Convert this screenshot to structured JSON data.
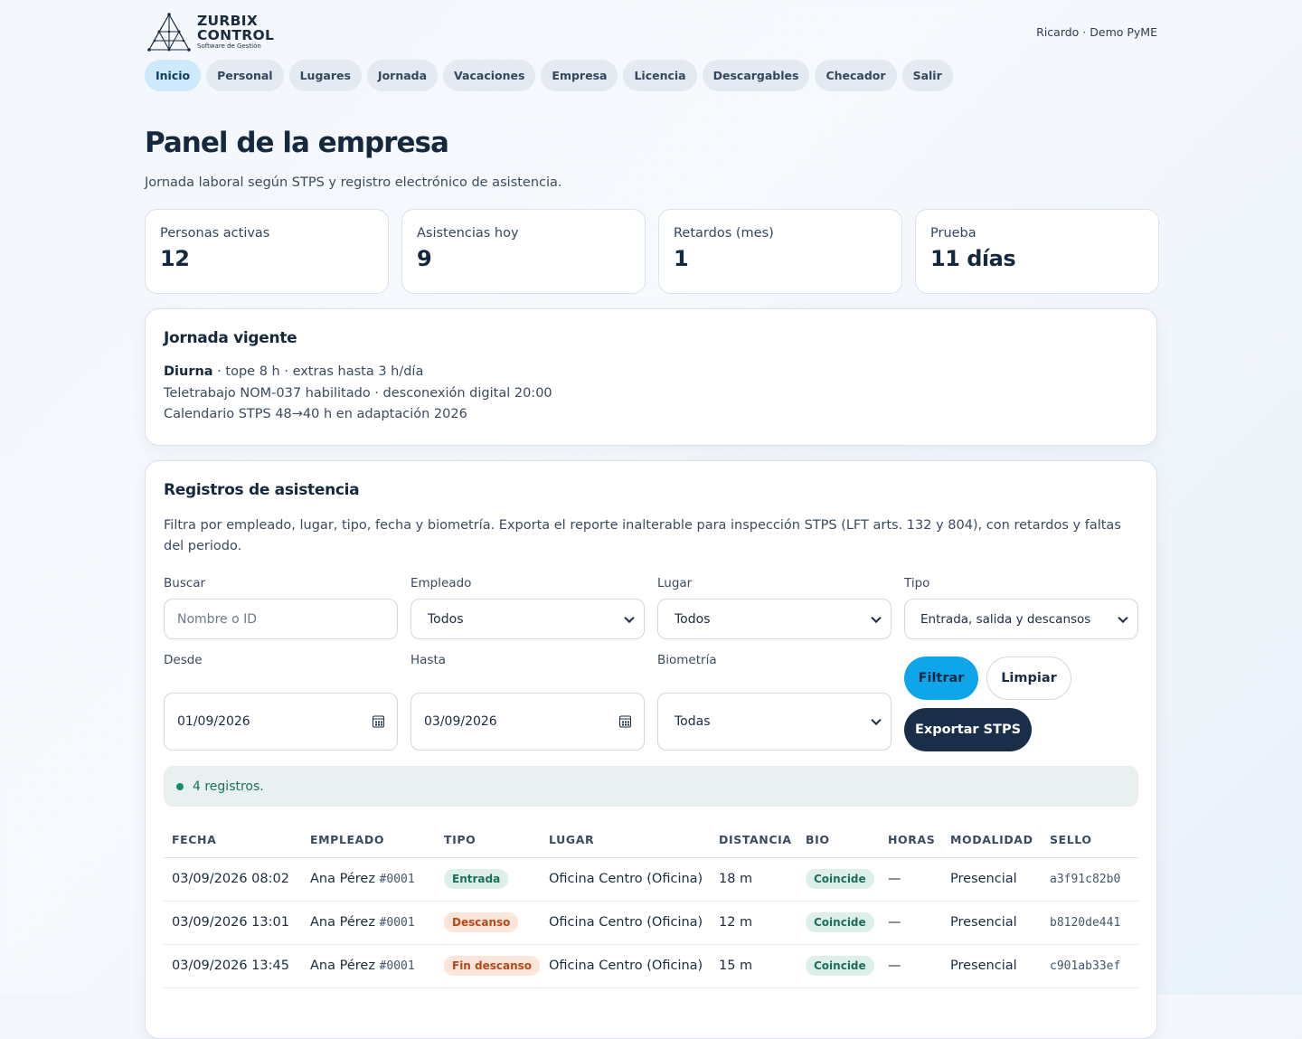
{
  "brand": {
    "name_line1": "ZURBIX",
    "name_line2": "CONTROL",
    "tagline": "Software de Gestión"
  },
  "user": "Ricardo · Demo PyME",
  "nav": [
    "Inicio",
    "Personal",
    "Lugares",
    "Jornada",
    "Vacaciones",
    "Empresa",
    "Licencia",
    "Descargables",
    "Checador",
    "Salir"
  ],
  "page": {
    "title": "Panel de la empresa",
    "subtitle": "Jornada laboral según STPS y registro electrónico de asistencia."
  },
  "stats": [
    {
      "label": "Personas activas",
      "value": "12"
    },
    {
      "label": "Asistencias hoy",
      "value": "9"
    },
    {
      "label": "Retardos (mes)",
      "value": "1"
    },
    {
      "label": "Prueba",
      "value": "11 días"
    }
  ],
  "jornada": {
    "title": "Jornada vigente",
    "line1_bold": "Diurna",
    "line1_rest": " · tope 8 h · extras hasta 3 h/día",
    "line2": "Teletrabajo NOM-037 habilitado · desconexión digital 20:00",
    "line3": "Calendario STPS 48→40 h en adaptación 2026"
  },
  "registros": {
    "title": "Registros de asistencia",
    "description": "Filtra por empleado, lugar, tipo, fecha y biometría. Exporta el reporte inalterable para inspección STPS (LFT arts. 132 y 804), con retardos y faltas del periodo.",
    "filters": {
      "buscar_label": "Buscar",
      "buscar_placeholder": "Nombre o ID",
      "empleado_label": "Empleado",
      "empleado_value": "Todos",
      "lugar_label": "Lugar",
      "lugar_value": "Todos",
      "tipo_label": "Tipo",
      "tipo_value": "Entrada, salida y descansos",
      "desde_label": "Desde",
      "desde_value": "01/09/2026",
      "hasta_label": "Hasta",
      "hasta_value": "03/09/2026",
      "biometria_label": "Biometría",
      "biometria_value": "Todas"
    },
    "buttons": {
      "filtrar": "Filtrar",
      "limpiar": "Limpiar",
      "exportar": "Exportar STPS"
    },
    "status": "4 registros.",
    "columns": [
      "FECHA",
      "EMPLEADO",
      "TIPO",
      "LUGAR",
      "DISTANCIA",
      "BIO",
      "HORAS",
      "MODALIDAD",
      "SELLO"
    ],
    "rows": [
      {
        "fecha": "03/09/2026 08:02",
        "empleado": "Ana Pérez",
        "id": "#0001",
        "tipo": "Entrada",
        "lugar": "Oficina Centro (Oficina)",
        "distancia": "18 m",
        "bio": "Coincide",
        "horas": "—",
        "modalidad": "Presencial",
        "sello": "a3f91c82b0"
      },
      {
        "fecha": "03/09/2026 13:01",
        "empleado": "Ana Pérez",
        "id": "#0001",
        "tipo": "Descanso",
        "lugar": "Oficina Centro (Oficina)",
        "distancia": "12 m",
        "bio": "Coincide",
        "horas": "—",
        "modalidad": "Presencial",
        "sello": "b8120de441"
      },
      {
        "fecha": "03/09/2026 13:45",
        "empleado": "Ana Pérez",
        "id": "#0001",
        "tipo": "Fin descanso",
        "lugar": "Oficina Centro (Oficina)",
        "distancia": "15 m",
        "bio": "Coincide",
        "horas": "—",
        "modalidad": "Presencial",
        "sello": "c901ab33ef"
      }
    ]
  }
}
